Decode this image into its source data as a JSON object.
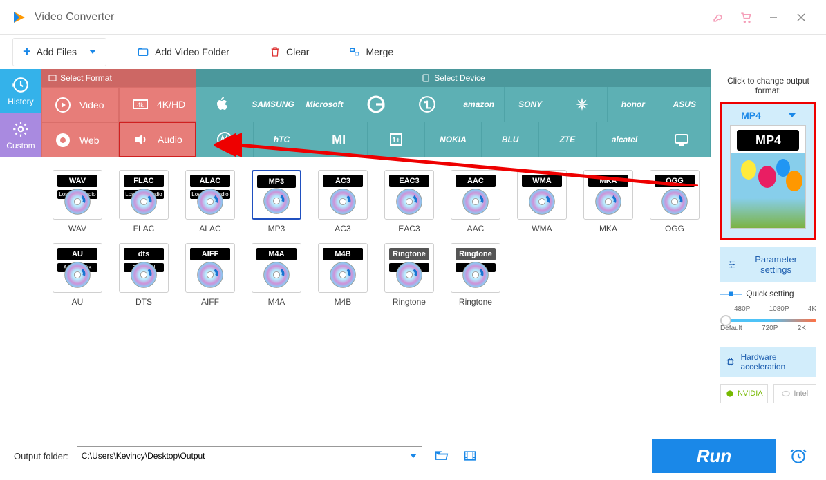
{
  "app": {
    "title": "Video Converter"
  },
  "toolbar": {
    "add_files": "Add Files",
    "add_video_folder": "Add Video Folder",
    "clear": "Clear",
    "merge": "Merge"
  },
  "left_tabs": {
    "history": "History",
    "custom": "Custom"
  },
  "format_header": {
    "select_format": "Select Format",
    "select_device": "Select Device",
    "video": "Video",
    "hd": "4K/HD",
    "web": "Web",
    "audio": "Audio"
  },
  "device_brands_row1": [
    "Apple",
    "SAMSUNG",
    "Microsoft",
    "G",
    "LG",
    "amazon",
    "SONY",
    "HUAWEI",
    "honor",
    "ASUS"
  ],
  "device_brands_row2": [
    "MOTOROLA",
    "hTC",
    "Mi",
    "OnePlus",
    "NOKIA",
    "BLU",
    "ZTE",
    "alcatel",
    "TV"
  ],
  "formats": [
    {
      "name": "WAV",
      "badge": "WAV",
      "sub": "Lossless Audio",
      "selected": false
    },
    {
      "name": "FLAC",
      "badge": "FLAC",
      "sub": "Lossless Audio",
      "selected": false
    },
    {
      "name": "ALAC",
      "badge": "ALAC",
      "sub": "Lossless Audio",
      "selected": false
    },
    {
      "name": "MP3",
      "badge": "MP3",
      "sub": "",
      "selected": true
    },
    {
      "name": "AC3",
      "badge": "AC3",
      "sub": "",
      "selected": false
    },
    {
      "name": "EAC3",
      "badge": "EAC3",
      "sub": "",
      "selected": false
    },
    {
      "name": "AAC",
      "badge": "AAC",
      "sub": "",
      "selected": false
    },
    {
      "name": "WMA",
      "badge": "WMA",
      "sub": "",
      "selected": false
    },
    {
      "name": "MKA",
      "badge": "MKA",
      "sub": "",
      "selected": false
    },
    {
      "name": "OGG",
      "badge": "OGG",
      "sub": "",
      "selected": false
    },
    {
      "name": "AU",
      "badge": "AU",
      "sub": "Audio Units",
      "selected": false
    },
    {
      "name": "DTS",
      "badge": "dts",
      "sub": "Surround",
      "selected": false
    },
    {
      "name": "AIFF",
      "badge": "AIFF",
      "sub": "",
      "selected": false
    },
    {
      "name": "M4A",
      "badge": "M4A",
      "sub": "",
      "selected": false
    },
    {
      "name": "M4B",
      "badge": "M4B",
      "sub": "",
      "selected": false
    },
    {
      "name": "Ringtone",
      "badge": "Ringtone",
      "sub": "apple",
      "selected": false,
      "ringtone": true
    },
    {
      "name": "Ringtone",
      "badge": "Ringtone",
      "sub": "android",
      "selected": false,
      "ringtone": true
    }
  ],
  "right": {
    "change_label": "Click to change output format:",
    "current_format": "MP4",
    "parameter_settings": "Parameter settings",
    "quick_setting": "Quick setting",
    "slider_top": [
      "480P",
      "1080P",
      "4K"
    ],
    "slider_bottom": [
      "Default",
      "720P",
      "2K"
    ],
    "hardware_accel": "Hardware acceleration",
    "nvidia": "NVIDIA",
    "intel": "Intel"
  },
  "bottom": {
    "output_folder_label": "Output folder:",
    "output_folder_path": "C:\\Users\\Kevincy\\Desktop\\Output",
    "run": "Run"
  }
}
